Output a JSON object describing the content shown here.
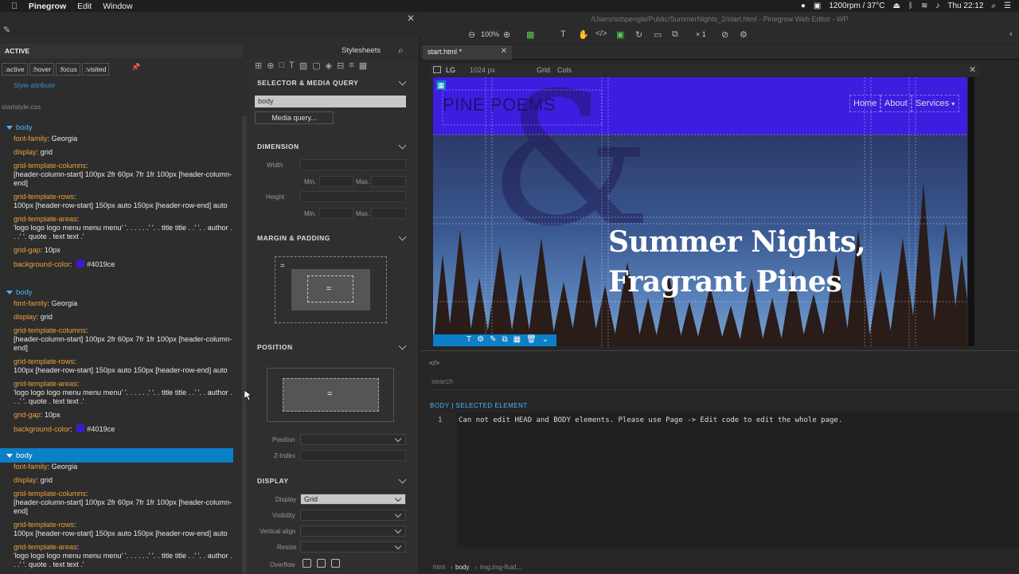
{
  "menubar": {
    "app": "Pinegrow",
    "items": [
      "Edit",
      "Window"
    ],
    "status": "1200rpm / 37°C",
    "clock": "Thu 22:12"
  },
  "window_title": "/Users/schpengle/Public/SummerNights_2/start.html - Pinegrow Web Editor - WP",
  "left": {
    "state_label": "ACTIVE",
    "stylesheets_label": "Stylesheets",
    "pseudo": [
      ":active",
      ":hover",
      ":focus",
      ":visited"
    ],
    "style_attribute": "Style attribute",
    "stylesheet_file": "startstyle.css",
    "rules": [
      {
        "selector": "body",
        "decls": [
          {
            "p": "font-family",
            "v": "Georgia"
          },
          {
            "p": "display",
            "v": "grid"
          },
          {
            "p": "grid-template-columns",
            "v": "[header-column-start] 100px 2fr 60px 7fr 1fr 100px [header-column-end]"
          },
          {
            "p": "grid-template-rows",
            "v": "100px [header-row-start] 150px auto 150px [header-row-end] auto"
          },
          {
            "p": "grid-template-areas",
            "v": "'logo logo logo menu menu menu' '. . . . . .' '. . title title . .' '. . author . . .' '. quote . text text .'"
          },
          {
            "p": "grid-gap",
            "v": "10px"
          },
          {
            "p": "background-color",
            "v": "#4019ce"
          }
        ]
      },
      {
        "selector": "body",
        "decls": [
          {
            "p": "font-family",
            "v": "Georgia"
          },
          {
            "p": "display",
            "v": "grid"
          },
          {
            "p": "grid-template-columns",
            "v": "[header-column-start] 100px 2fr 60px 7fr 1fr 100px [header-column-end]"
          },
          {
            "p": "grid-template-rows",
            "v": "100px [header-row-start] 150px auto 150px [header-row-end] auto"
          },
          {
            "p": "grid-template-areas",
            "v": "'logo logo logo menu menu menu' '. . . . . .' '. . title title . .' '. . author . . .' '. quote . text text .'"
          },
          {
            "p": "grid-gap",
            "v": "10px"
          },
          {
            "p": "background-color",
            "v": "#4019ce"
          }
        ]
      },
      {
        "selector": "body",
        "decls": [
          {
            "p": "font-family",
            "v": "Georgia"
          },
          {
            "p": "display",
            "v": "grid"
          },
          {
            "p": "grid-template-columns",
            "v": "[header-column-start] 100px 2fr 60px 7fr 1fr 100px [header-column-end]"
          },
          {
            "p": "grid-template-rows",
            "v": "100px [header-row-start] 150px auto 150px [header-row-end] auto"
          },
          {
            "p": "grid-template-areas",
            "v": "'logo logo logo menu menu menu' '. . . . . .' '. . title title . .' '. . author . . .' '. quote . text text .'"
          }
        ]
      }
    ]
  },
  "props": {
    "selector_title": "SELECTOR & MEDIA QUERY",
    "selector_value": "body",
    "media_query_btn": "Media query...",
    "dimension_title": "DIMENSION",
    "width": "Width",
    "height": "Height",
    "min": "Min.",
    "max": "Max.",
    "margin_title": "MARGIN & PADDING",
    "position_title": "POSITION",
    "position_label": "Position",
    "zindex_label": "Z-Index",
    "display_title": "DISPLAY",
    "display_label": "Display",
    "display_value": "Grid",
    "visibility_label": "Visibility",
    "valign_label": "Vertical align",
    "resize_label": "Resize",
    "overflow_label": "Overflow"
  },
  "toolbar": {
    "zoom": "100%",
    "multiplier": "× 1"
  },
  "tab": {
    "label": "start.html *"
  },
  "canvasbar": {
    "device": "LG",
    "width": "1024 px",
    "grid": "Grid",
    "cols": "Cols"
  },
  "site": {
    "brand": "PINE POEMS",
    "nav": [
      "Home",
      "About",
      "Services"
    ],
    "amp": "&",
    "headline_1": "Summer Nights,",
    "headline_2": "Fragrant Pines"
  },
  "code": {
    "search_placeholder": "search",
    "selected": "BODY | SELECTED ELEMENT",
    "line_no": "1",
    "message": "Can not edit HEAD and BODY elements. Please use Page -> Edit code to edit the whole page."
  },
  "crumbs": [
    "html",
    "body",
    "img.img-fluid..."
  ],
  "colors": {
    "accent": "#0b7fc7",
    "bg_color": "#4019ce"
  }
}
